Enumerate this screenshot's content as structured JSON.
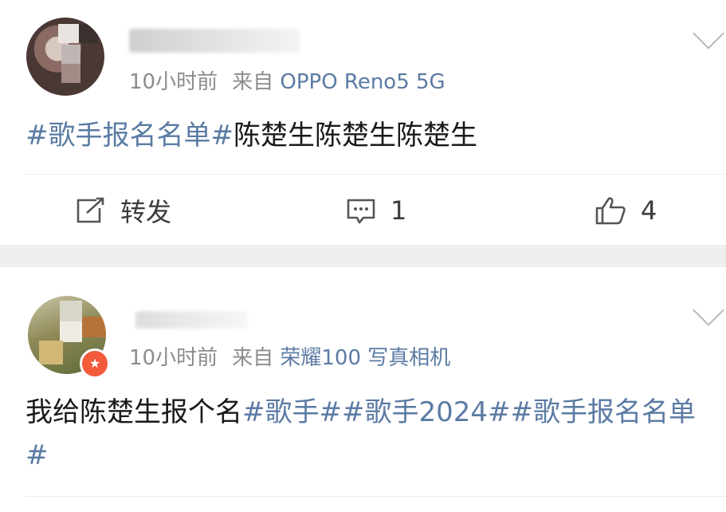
{
  "posts": [
    {
      "time": "10小时前",
      "from_label": "来自",
      "source": "OPPO Reno5 5G",
      "content": {
        "tags": [
          "#歌手报名名单#"
        ],
        "text": "陈楚生陈楚生陈楚生"
      },
      "actions": {
        "repost_label": "转发",
        "comments": "1",
        "likes": "4"
      }
    },
    {
      "time": "10小时前",
      "from_label": "来自",
      "source": "荣耀100 写真相机",
      "content": {
        "text": "我给陈楚生报个名",
        "tags": [
          "#歌手#",
          "#歌手2024#",
          "#歌手报名名单#"
        ]
      }
    }
  ],
  "icons": {
    "repost": "repost-icon",
    "comment": "comment-icon",
    "like": "thumbs-up-icon",
    "more": "chevron-down-icon",
    "badge": "verified-badge-icon"
  },
  "colors": {
    "link": "#5b7ba3",
    "meta": "#8c8c8c",
    "separator": "#eeeeee"
  }
}
